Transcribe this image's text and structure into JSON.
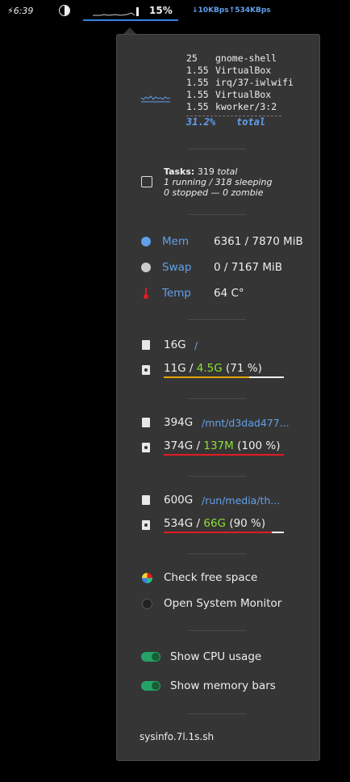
{
  "topbar": {
    "clock": "⚡6:39",
    "cpu_percent": "15%",
    "net": "↓10KBps↑534KBps"
  },
  "processes": [
    {
      "value": "25",
      "name": "gnome-shell"
    },
    {
      "value": "1.55",
      "name": "VirtualBox"
    },
    {
      "value": "1.55",
      "name": "irq/37-iwlwifi"
    },
    {
      "value": "1.55",
      "name": "VirtualBox"
    },
    {
      "value": "1.55",
      "name": "kworker/3:2"
    }
  ],
  "cpu_total": {
    "value": "31.2%",
    "label": "total"
  },
  "tasks": {
    "title": "Tasks:",
    "total_count": "319",
    "total_label": "total",
    "line2": "1 running / 318 sleeping",
    "line3": "0 stopped  —  0 zombie"
  },
  "stats": {
    "mem_label": "Mem",
    "mem_value": "6361 / 7870 MiB",
    "swap_label": "Swap",
    "swap_value": "0 / 7167 MiB",
    "temp_label": "Temp",
    "temp_value": "64 C°"
  },
  "drives": [
    {
      "size": "16G",
      "path": "/",
      "used": "11G",
      "sep": " / ",
      "free": "4.5G",
      "pct": "(71 %)",
      "fill": 0.71,
      "color": "#e5a50a"
    },
    {
      "size": "394G",
      "path": "/mnt/d3dad477...",
      "used": "374G",
      "sep": " / ",
      "free": "137M",
      "pct": "(100 %)",
      "fill": 1.0,
      "color": "#e01b24"
    },
    {
      "size": "600G",
      "path": "/run/media/th...",
      "used": "534G",
      "sep": " / ",
      "free": "66G",
      "pct": "(90 %)",
      "fill": 0.9,
      "color": "#e01b24"
    }
  ],
  "actions": {
    "check_free_space": "Check free space",
    "open_system_monitor": "Open System Monitor"
  },
  "toggles": {
    "show_cpu_usage": "Show CPU usage",
    "show_memory_bars": "Show memory bars"
  },
  "footer": "sysinfo.7l.1s.sh",
  "colors": {
    "accent": "#62a0ea",
    "free": "#8ae234",
    "toggle_on": "#26a269",
    "menu_bg": "#353535"
  }
}
